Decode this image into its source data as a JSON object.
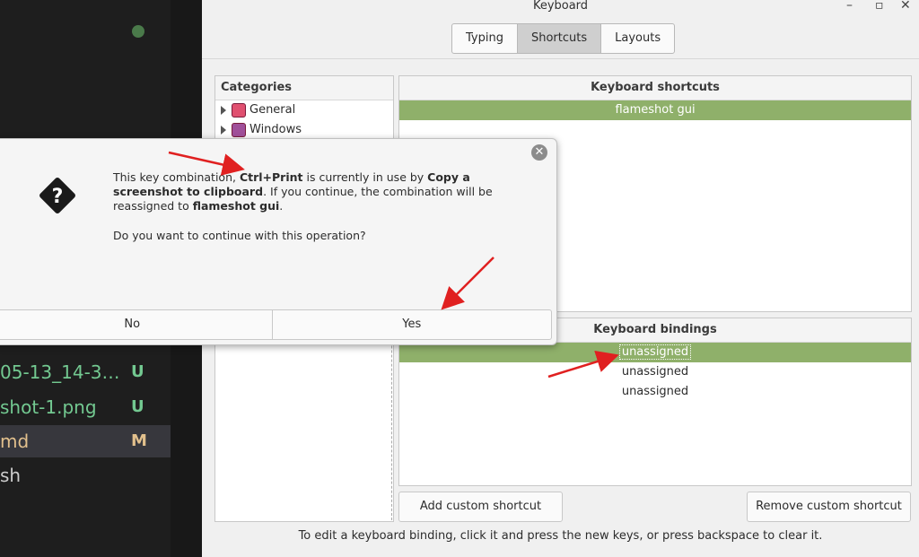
{
  "editor": {
    "rows": [
      {
        "name": "05-13_14-3…",
        "badge": "U",
        "color": "#73c991",
        "selected": false
      },
      {
        "name": "shot-1.png",
        "badge": "U",
        "color": "#73c991",
        "selected": false
      },
      {
        "name": "md",
        "badge": "M",
        "color": "#e2c08d",
        "selected": true
      },
      {
        "name": "sh",
        "badge": "",
        "color": "#cccccc",
        "selected": false
      }
    ]
  },
  "window": {
    "title": "Keyboard",
    "tabs": [
      "Typing",
      "Shortcuts",
      "Layouts"
    ],
    "active_tab": "Shortcuts"
  },
  "categories": {
    "header": "Categories",
    "items": [
      {
        "label": "General",
        "icon_color": "#e05070"
      },
      {
        "label": "Windows",
        "icon_color": "#a0509a"
      }
    ]
  },
  "shortcuts": {
    "header": "Keyboard shortcuts",
    "items": [
      "flameshot gui"
    ]
  },
  "bindings": {
    "header": "Keyboard bindings",
    "items": [
      "unassigned",
      "unassigned",
      "unassigned"
    ]
  },
  "buttons": {
    "add": "Add custom shortcut",
    "remove": "Remove custom shortcut"
  },
  "hint": "To edit a keyboard binding, click it and press the new keys, or press backspace to clear it.",
  "dialog": {
    "msg_1": "This key combination, ",
    "key": "Ctrl+Print",
    "msg_2": " is currently in use by ",
    "existing": "Copy a screenshot to clipboard",
    "msg_3": ".  If you continue, the combination will be reassigned to ",
    "target": "flameshot gui",
    "msg_4": ".",
    "question": "Do you want to continue with this operation?",
    "no": "No",
    "yes": "Yes",
    "close_glyph": "✕"
  },
  "colors": {
    "selection": "#8fb06a",
    "arrow": "#e02020"
  }
}
